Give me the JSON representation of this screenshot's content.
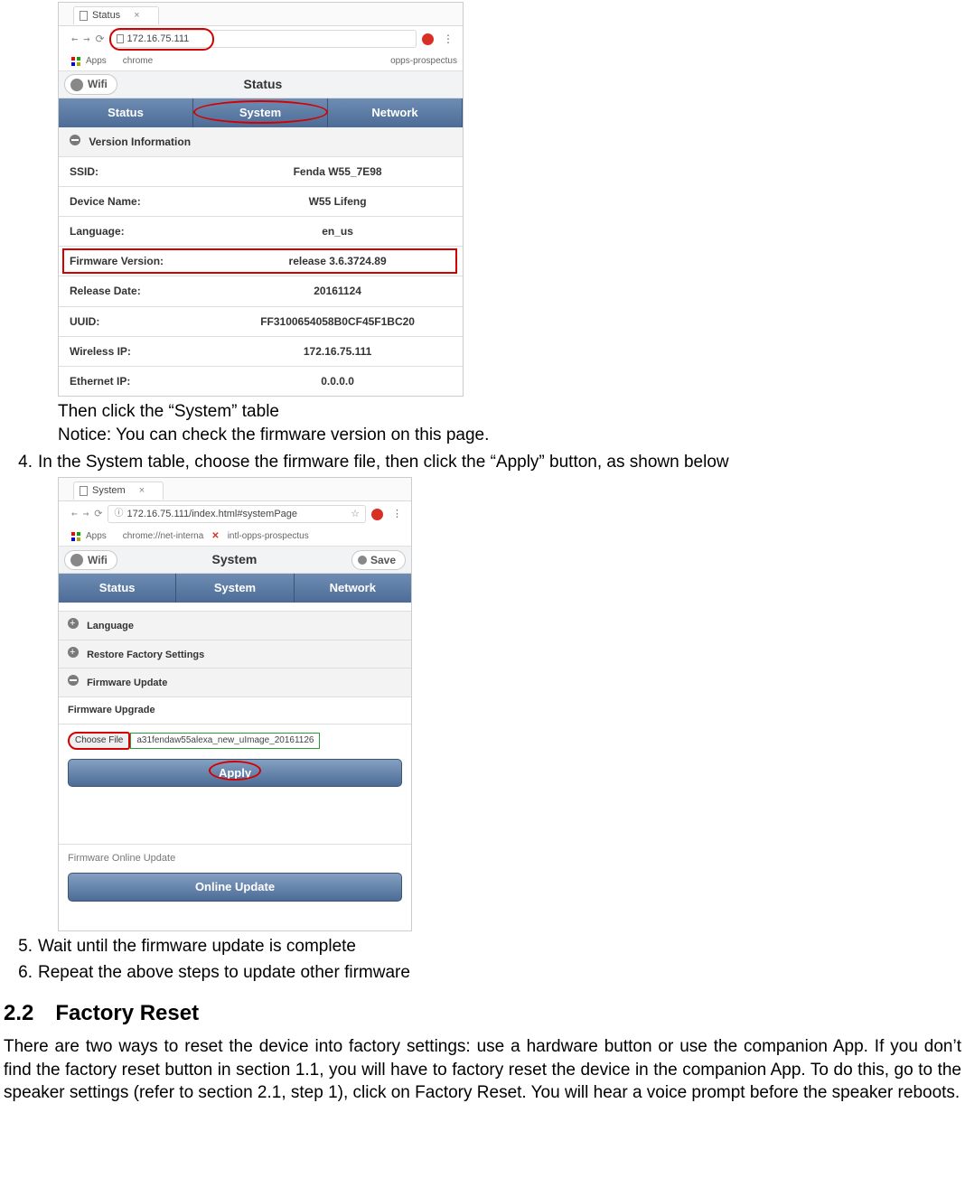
{
  "shot1": {
    "tab_title": "Status",
    "address_url": "172.16.75.111",
    "bookmarks": {
      "apps": "Apps",
      "chrome": "chrome",
      "prospectus": "opps-prospectus"
    },
    "header": {
      "wifi": "Wifi",
      "title": "Status"
    },
    "tabs": {
      "status": "Status",
      "system": "System",
      "network": "Network"
    },
    "acc_title": "Version Information",
    "rows": {
      "ssid_l": "SSID:",
      "ssid_v": "Fenda W55_7E98",
      "dev_l": "Device Name:",
      "dev_v": "W55 Lifeng",
      "lang_l": "Language:",
      "lang_v": "en_us",
      "fw_l": "Firmware Version:",
      "fw_v": "release 3.6.3724.89",
      "rel_l": "Release Date:",
      "rel_v": "20161124",
      "uuid_l": "UUID:",
      "uuid_v": "FF3100654058B0CF45F1BC20",
      "wip_l": "Wireless IP:",
      "wip_v": "172.16.75.111",
      "eip_l": "Ethernet IP:",
      "eip_v": "0.0.0.0"
    }
  },
  "text_after_shot1_a": "Then click the “System” table",
  "text_after_shot1_b": "Notice: You can check the firmware version on this page.",
  "step4_num": "4.",
  "step4_txt": "In the System table, choose the firmware file, then click the “Apply” button, as shown below",
  "shot2": {
    "tab_title": "System",
    "address_url": "172.16.75.111/index.html#systemPage",
    "bookmarks": {
      "apps": "Apps",
      "chrome": "chrome://net-interna",
      "intl": "intl-opps-prospectus"
    },
    "header": {
      "wifi": "Wifi",
      "title": "System",
      "save": "Save"
    },
    "tabs": {
      "status": "Status",
      "system": "System",
      "network": "Network"
    },
    "acc": {
      "lang": "Language",
      "restore": "Restore Factory Settings",
      "fw": "Firmware Update"
    },
    "fw_upgrade_title": "Firmware Upgrade",
    "choose_btn": "Choose File",
    "choose_val": "a31fendaw55alexa_new_uImage_20161126",
    "apply_btn": "Apply",
    "online_title": "Firmware Online Update",
    "online_btn": "Online Update"
  },
  "step5_num": "5.",
  "step5_txt": "Wait until the firmware update is complete",
  "step6_num": "6.",
  "step6_txt": "Repeat the above steps to update other firmware",
  "section_h": "2.2 Factory Reset",
  "para": "There are two ways to reset the device into factory settings: use a hardware button or use the companion App. If you don’t find the factory reset button in section 1.1, you will have to factory reset the device in the companion App. To do this, go to the speaker settings (refer to section 2.1, step 1), click on Factory Reset. You will hear a voice prompt before the speaker reboots."
}
